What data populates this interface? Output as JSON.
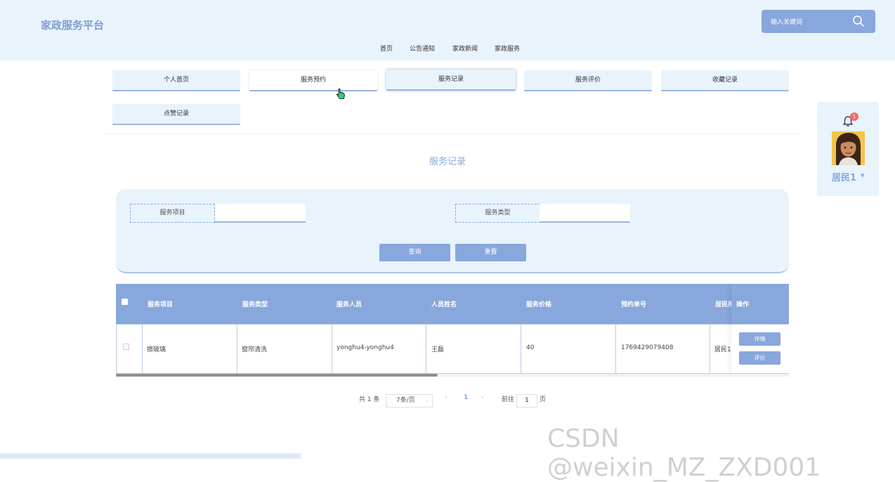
{
  "header": {
    "logo": "家政服务平台",
    "search_placeholder": "输入关键词",
    "nav": [
      "首页",
      "公告通知",
      "家政新闻",
      "家政服务"
    ]
  },
  "tabs": [
    "个人首页",
    "服务预约",
    "服务记录",
    "服务评价",
    "收藏记录",
    "点赞记录"
  ],
  "user": {
    "name": "居民1",
    "badge": "1"
  },
  "page": {
    "title": "服务记录"
  },
  "filter": {
    "label1": "服务项目",
    "label2": "服务类型",
    "value1": "",
    "value2": "",
    "query_button": "查询",
    "reset_button": "重置"
  },
  "table": {
    "headers": [
      "服务项目",
      "服务类型",
      "服务人员",
      "人员姓名",
      "服务价格",
      "预约单号",
      "居民用",
      "操作"
    ],
    "rows": [
      {
        "item": "擦玻璃",
        "type": "窗帘清洗",
        "staff": "yonghu4-yonghu4",
        "staff_name": "王磊",
        "price": "40",
        "order_no": "1769429079408",
        "resident": "居民1",
        "detail_button": "详情",
        "review_button": "评价"
      }
    ]
  },
  "pagination": {
    "total": "共 1 条",
    "page_size": "7条/页",
    "current": "1",
    "goto_label": "前往",
    "goto_value": "1",
    "page_suffix": "页"
  },
  "watermark": "CSDN @weixin_MZ_ZXD001",
  "colors": {
    "accent": "#88a7dc",
    "light_bg": "#e8f3fc",
    "badge": "#f56c6c"
  }
}
